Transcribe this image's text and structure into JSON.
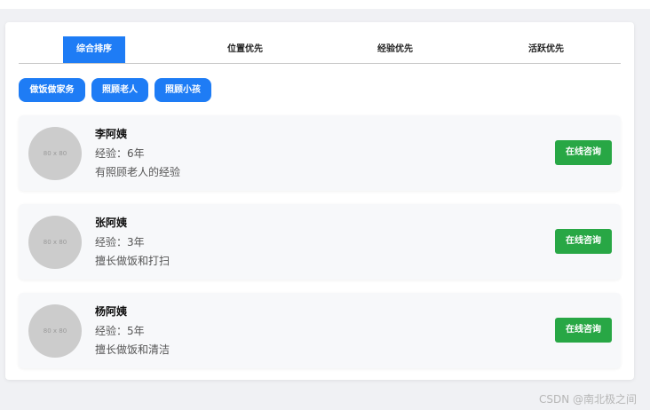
{
  "tabs": [
    {
      "label": "综合排序",
      "active": true
    },
    {
      "label": "位置优先",
      "active": false
    },
    {
      "label": "经验优先",
      "active": false
    },
    {
      "label": "活跃优先",
      "active": false
    }
  ],
  "tags": [
    "做饭做家务",
    "照顾老人",
    "照顾小孩"
  ],
  "cards": [
    {
      "avatar_placeholder": "80 x 80",
      "name": "李阿姨",
      "experience": "经验：6年",
      "description": "有照顾老人的经验",
      "button": "在线咨询"
    },
    {
      "avatar_placeholder": "80 x 80",
      "name": "张阿姨",
      "experience": "经验：3年",
      "description": "擅长做饭和打扫",
      "button": "在线咨询"
    },
    {
      "avatar_placeholder": "80 x 80",
      "name": "杨阿姨",
      "experience": "经验：5年",
      "description": "擅长做饭和清洁",
      "button": "在线咨询"
    }
  ],
  "watermark": "CSDN @南北极之间",
  "colors": {
    "primary": "#1e7cf5",
    "success": "#28a745",
    "avatar": "#cccccc"
  }
}
